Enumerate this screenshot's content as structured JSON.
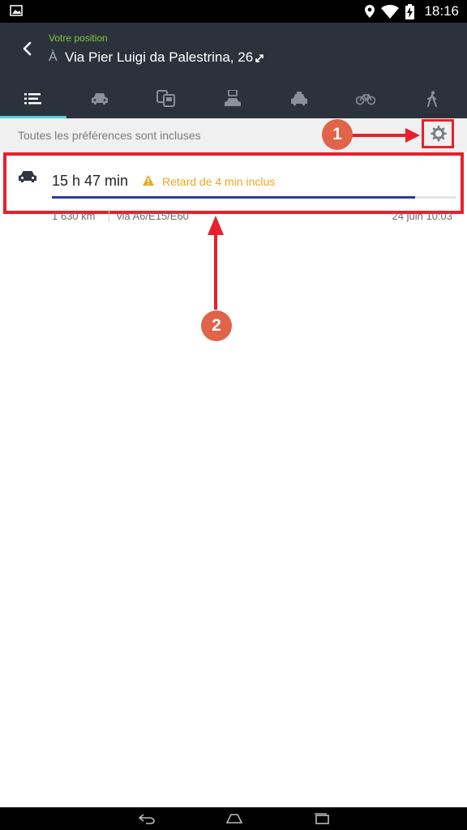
{
  "status_bar": {
    "time": "18:16",
    "icons": [
      "image-icon",
      "location-icon",
      "wifi-icon",
      "battery-charging-icon"
    ]
  },
  "header": {
    "from_label": "Votre position",
    "to_prefix": "À",
    "to_address": "Via Pier Luigi da Palestrina, 26"
  },
  "tabs": [
    {
      "icon": "list-icon",
      "active": true
    },
    {
      "icon": "car-icon"
    },
    {
      "icon": "public-transport-icon"
    },
    {
      "icon": "car-and-train-icon"
    },
    {
      "icon": "taxi-icon"
    },
    {
      "icon": "bicycle-icon"
    },
    {
      "icon": "walk-icon"
    }
  ],
  "preferences": {
    "text": "Toutes les préférences sont incluses"
  },
  "route": {
    "duration": "15 h 47 min",
    "delay": "Retard de 4 min inclus",
    "distance": "1 630 km",
    "via": "via A6/E15/E60",
    "arrival": "24 juin 10:03",
    "progress_fraction": 0.9
  },
  "annotations": {
    "badge_1": "1",
    "badge_2": "2"
  },
  "colors": {
    "header_bg": "#2c323b",
    "accent_green": "#7ec83a",
    "tab_indicator": "#4fd5d5",
    "delay_orange": "#f1a51a",
    "progress_blue": "#27409a",
    "annotation_red": "#e8202a",
    "badge_orange": "#e0634a"
  }
}
